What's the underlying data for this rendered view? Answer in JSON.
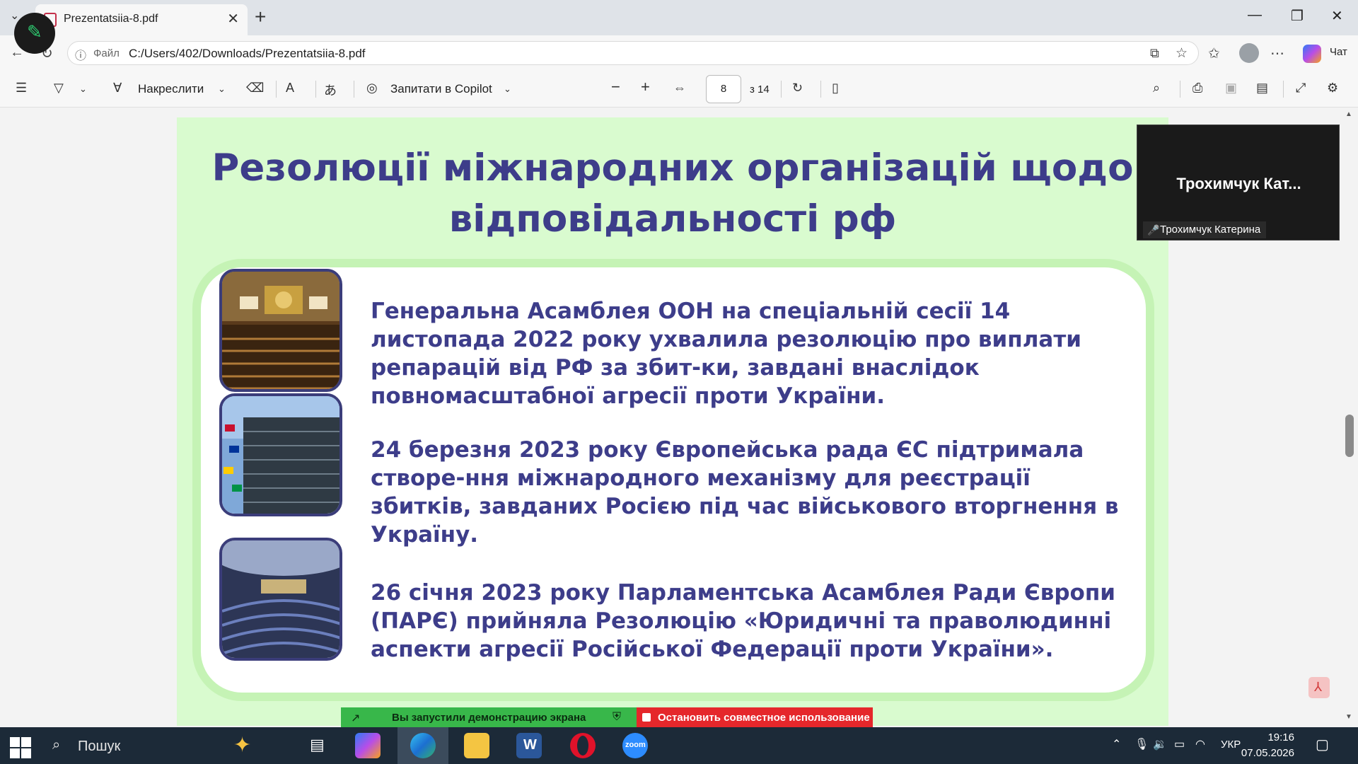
{
  "browser": {
    "tab_title": "Prezentatsiia-8.pdf",
    "address_label": "Файл",
    "url": "C:/Users/402/Downloads/Prezentatsiia-8.pdf",
    "chat_label": "Чат"
  },
  "pdf_toolbar": {
    "draw_label": "Накреслити",
    "copilot_label": "Запитати в Copilot",
    "current_page": "8",
    "page_total": "з 14"
  },
  "slide": {
    "title_line1": "Резолюції міжнародних організацій щодо",
    "title_line2": "відповідальності рф",
    "items": [
      {
        "text": "Генеральна Асамблея ООН на спеціальній сесії 14 листопада 2022 року ухвалила резолюцію про виплати репарацій від РФ за збит-ки, завдані внаслідок повномасштабної агресії проти України."
      },
      {
        "text": "24 березня 2023 року Європейська рада ЄС підтримала створе-ння міжнародного механізму для  реєстрації збитків, завданих Росією під час військового вторгнення в Україну."
      },
      {
        "text": "26 січня 2023 року Парламентська Асамблея Ради Європи (ПАРЄ) прийняла Резолюцію «Юридичні та праволюдинні аспекти агресії Російської Федерації проти України»."
      }
    ]
  },
  "zoom": {
    "participant_short": "Трохимчук  Кат...",
    "participant_full": "Трохимчук Катерина",
    "share_notice": "Вы запустили демонстрацию экрана",
    "stop_share": "Остановить совместное использование"
  },
  "taskbar": {
    "search_placeholder": "Пошук",
    "language": "УКР",
    "time": "19:16",
    "date": "07.05.2026"
  }
}
